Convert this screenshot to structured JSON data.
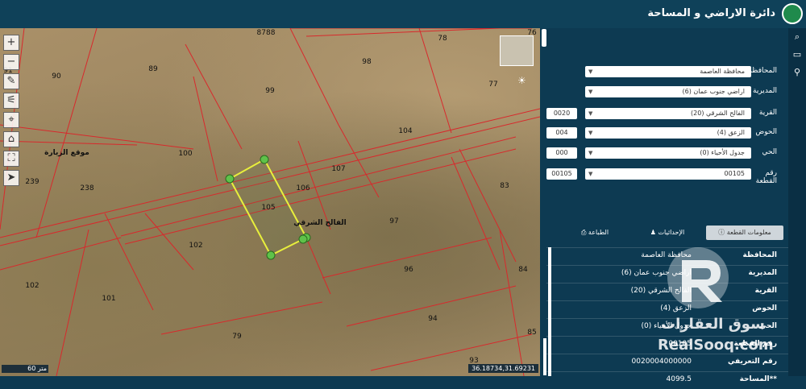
{
  "header": {
    "title": "دائرة الاراضي و المساحة"
  },
  "map": {
    "parcels": [
      "8788",
      "78",
      "76",
      "89",
      "90",
      "98",
      "77",
      "99",
      "104",
      "100",
      "107",
      "83",
      "239",
      "238",
      "106",
      "105",
      "97",
      "102",
      "96",
      "84",
      "101",
      "94",
      "79",
      "93",
      "85",
      "102"
    ],
    "labels": {
      "site": "موقع الزيارة",
      "village": "الفالح الشرقي",
      "scale": "60 متر",
      "coords": "36.18734,31.69231",
      "left_edge": "91",
      "left_edge2": "60"
    }
  },
  "tools": [
    "+",
    "−",
    "✎",
    "⚟",
    "⌖",
    "⌂",
    "⛶",
    "➤"
  ],
  "form": {
    "governorate": {
      "label": "المحافظة",
      "value": "محافظة العاصمة"
    },
    "directorate": {
      "label": "المديرية",
      "value": "اراضي جنوب عمان (6)"
    },
    "village": {
      "label": "القرية",
      "value": "الفالح الشرقي (20)",
      "code": "0020"
    },
    "basin": {
      "label": "الحوض",
      "value": "الزعق (4)",
      "code": "004"
    },
    "district": {
      "label": "الحي",
      "value": "جدول الأحياء (0)",
      "code": "000"
    },
    "plot": {
      "label": "رقم القطعة",
      "value": "00105",
      "code": "00105"
    }
  },
  "tabs": {
    "info": "معلومات القطعة",
    "coords": "الإحداثيات",
    "print": "الطباعة"
  },
  "info": [
    {
      "k": "المحافظة",
      "v": "محافظة العاصمة"
    },
    {
      "k": "المديرية",
      "v": "اراضي جنوب عمان (6)"
    },
    {
      "k": "القرية",
      "v": "الفالح الشرقي (20)"
    },
    {
      "k": "الحوض",
      "v": "الزعق (4)"
    },
    {
      "k": "الحي",
      "v": "جدول الأحياء (0)"
    },
    {
      "k": "رقم القطعة",
      "v": "00105"
    },
    {
      "k": "رقم التعريفي",
      "v": "0020004000000"
    },
    {
      "k": "**المساحة",
      "v": "4099.5"
    }
  ],
  "watermark": {
    "line1": "سوق العقارات",
    "line2": "RealSooq.com"
  }
}
